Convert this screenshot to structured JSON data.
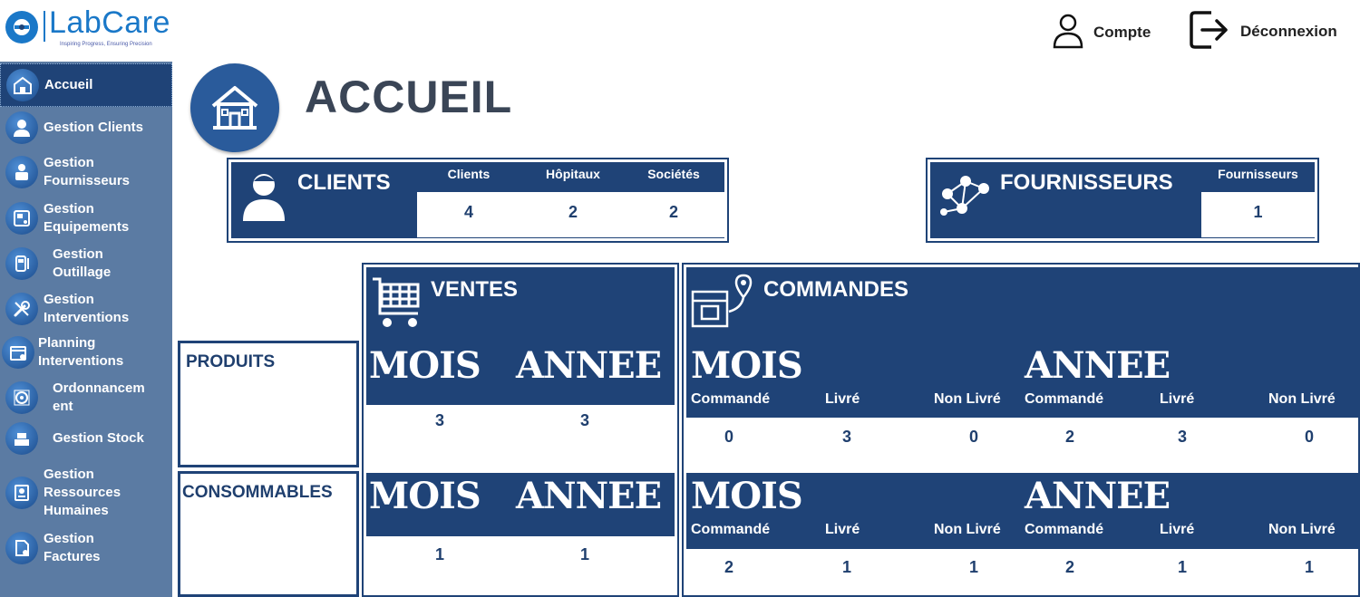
{
  "app": {
    "logo_text": "LabCare",
    "logo_tagline": "Inspiring Progress, Ensuring Precision"
  },
  "header": {
    "account_label": "Compte",
    "logout_label": "Déconnexion"
  },
  "sidebar": {
    "items": [
      {
        "label": "Accueil",
        "icon": "home-icon"
      },
      {
        "label": "Gestion Clients",
        "icon": "client-icon"
      },
      {
        "label": "Gestion\nFournisseurs",
        "icon": "supplier-icon"
      },
      {
        "label": "Gestion\nEquipements",
        "icon": "equipment-icon"
      },
      {
        "label": "Gestion\nOutillage",
        "icon": "tool-icon"
      },
      {
        "label": "Gestion\nInterventions",
        "icon": "wrench-icon"
      },
      {
        "label": "Planning\nInterventions",
        "icon": "calendar-icon"
      },
      {
        "label": "Ordonnancem\nent",
        "icon": "gear-icon"
      },
      {
        "label": "Gestion Stock",
        "icon": "stock-icon"
      },
      {
        "label": "Gestion\nRessources\nHumaines",
        "icon": "hr-icon"
      },
      {
        "label": "Gestion\nFactures",
        "icon": "invoice-icon"
      }
    ]
  },
  "page": {
    "title": "ACCUEIL"
  },
  "clients_card": {
    "title": "CLIENTS",
    "columns": [
      "Clients",
      "Hôpitaux",
      "Sociétés"
    ],
    "values": [
      "4",
      "2",
      "2"
    ]
  },
  "suppliers_card": {
    "title": "FOURNISSEURS",
    "column": "Fournisseurs",
    "value": "1"
  },
  "rows": {
    "produits": "PRODUITS",
    "consommables": "CONSOMMABLES"
  },
  "ventes": {
    "title": "VENTES",
    "month_label": "MOIS",
    "year_label": "ANNEE",
    "produits": {
      "mois": "3",
      "annee": "3"
    },
    "consommables": {
      "mois": "1",
      "annee": "1"
    }
  },
  "commandes": {
    "title": "COMMANDES",
    "month_label": "MOIS",
    "year_label": "ANNEE",
    "sub_labels": [
      "Commandé",
      "Livré",
      "Non Livré",
      "Commandé",
      "Livré",
      "Non Livré"
    ],
    "produits": [
      "0",
      "3",
      "0",
      "2",
      "3",
      "0"
    ],
    "consommables": [
      "2",
      "1",
      "1",
      "2",
      "1",
      "1"
    ]
  },
  "colors": {
    "navy": "#1f4377",
    "sidebar": "#5b7ba3",
    "accent": "#1a78c8"
  }
}
